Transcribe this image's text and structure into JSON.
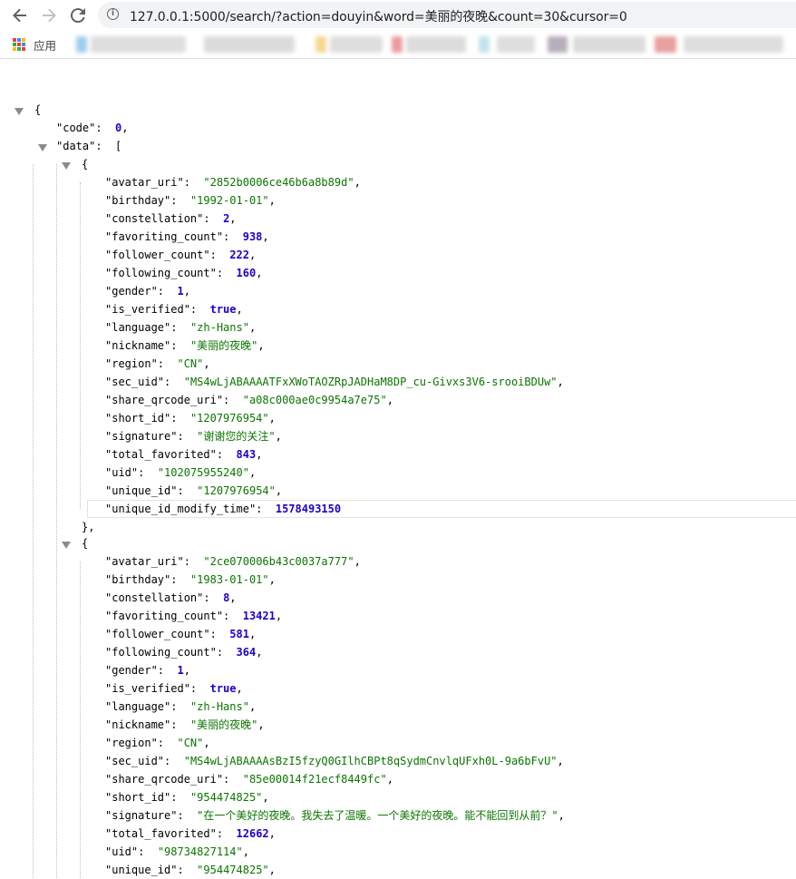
{
  "browser": {
    "url": "127.0.0.1:5000/search/?action=douyin&word=美丽的夜晚&count=30&cursor=0",
    "apps_label": "应用"
  },
  "json_view": {
    "code_key": "\"code\"",
    "code_value": "0",
    "data_key": "\"data\"",
    "items": [
      {
        "fields": [
          {
            "key": "\"avatar_uri\"",
            "value": "\"2852b0006ce46b6a8b89d\"",
            "type": "s"
          },
          {
            "key": "\"birthday\"",
            "value": "\"1992-01-01\"",
            "type": "s"
          },
          {
            "key": "\"constellation\"",
            "value": "2",
            "type": "n"
          },
          {
            "key": "\"favoriting_count\"",
            "value": "938",
            "type": "n"
          },
          {
            "key": "\"follower_count\"",
            "value": "222",
            "type": "n"
          },
          {
            "key": "\"following_count\"",
            "value": "160",
            "type": "n"
          },
          {
            "key": "\"gender\"",
            "value": "1",
            "type": "n"
          },
          {
            "key": "\"is_verified\"",
            "value": "true",
            "type": "b"
          },
          {
            "key": "\"language\"",
            "value": "\"zh-Hans\"",
            "type": "s"
          },
          {
            "key": "\"nickname\"",
            "value": "\"美丽的夜晚\"",
            "type": "s"
          },
          {
            "key": "\"region\"",
            "value": "\"CN\"",
            "type": "s"
          },
          {
            "key": "\"sec_uid\"",
            "value": "\"MS4wLjABAAAATFxXWoTAOZRpJADHaM8DP_cu-Givxs3V6-srooiBDUw\"",
            "type": "s"
          },
          {
            "key": "\"share_qrcode_uri\"",
            "value": "\"a08c000ae0c9954a7e75\"",
            "type": "s"
          },
          {
            "key": "\"short_id\"",
            "value": "\"1207976954\"",
            "type": "s"
          },
          {
            "key": "\"signature\"",
            "value": "\"谢谢您的关注\"",
            "type": "s"
          },
          {
            "key": "\"total_favorited\"",
            "value": "843",
            "type": "n"
          },
          {
            "key": "\"uid\"",
            "value": "\"102075955240\"",
            "type": "s"
          },
          {
            "key": "\"unique_id\"",
            "value": "\"1207976954\"",
            "type": "s"
          },
          {
            "key": "\"unique_id_modify_time\"",
            "value": "1578493150",
            "type": "n"
          }
        ]
      },
      {
        "fields": [
          {
            "key": "\"avatar_uri\"",
            "value": "\"2ce070006b43c0037a777\"",
            "type": "s"
          },
          {
            "key": "\"birthday\"",
            "value": "\"1983-01-01\"",
            "type": "s"
          },
          {
            "key": "\"constellation\"",
            "value": "8",
            "type": "n"
          },
          {
            "key": "\"favoriting_count\"",
            "value": "13421",
            "type": "n"
          },
          {
            "key": "\"follower_count\"",
            "value": "581",
            "type": "n"
          },
          {
            "key": "\"following_count\"",
            "value": "364",
            "type": "n"
          },
          {
            "key": "\"gender\"",
            "value": "1",
            "type": "n"
          },
          {
            "key": "\"is_verified\"",
            "value": "true",
            "type": "b"
          },
          {
            "key": "\"language\"",
            "value": "\"zh-Hans\"",
            "type": "s"
          },
          {
            "key": "\"nickname\"",
            "value": "\"美丽的夜晚\"",
            "type": "s"
          },
          {
            "key": "\"region\"",
            "value": "\"CN\"",
            "type": "s"
          },
          {
            "key": "\"sec_uid\"",
            "value": "\"MS4wLjABAAAAsBzI5fzyQ0GIlhCBPt8qSydmCnvlqUFxh0L-9a6bFvU\"",
            "type": "s"
          },
          {
            "key": "\"share_qrcode_uri\"",
            "value": "\"85e00014f21ecf8449fc\"",
            "type": "s"
          },
          {
            "key": "\"short_id\"",
            "value": "\"954474825\"",
            "type": "s"
          },
          {
            "key": "\"signature\"",
            "value": "\"在一个美好的夜晚。我失去了温暖。一个美好的夜晚。能不能回到从前？\"",
            "type": "s"
          },
          {
            "key": "\"total_favorited\"",
            "value": "12662",
            "type": "n"
          },
          {
            "key": "\"uid\"",
            "value": "\"98734827114\"",
            "type": "s"
          },
          {
            "key": "\"unique_id\"",
            "value": "\"954474825\"",
            "type": "s"
          }
        ]
      }
    ]
  }
}
